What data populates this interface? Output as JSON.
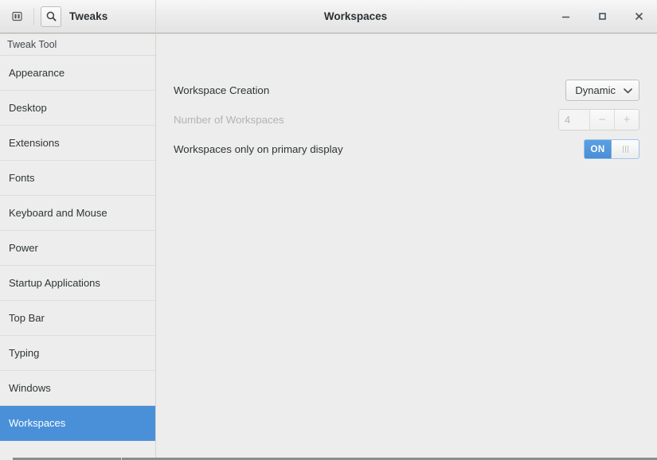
{
  "titlebar": {
    "sidebar_toggle_icon": "panel-toggle-icon",
    "search_icon": "search-icon",
    "app_name": "Tweaks",
    "window_title": "Workspaces",
    "minimize_label": "–",
    "maximize_label": "□",
    "close_label": "✕"
  },
  "sidebar": {
    "header": "Tweak Tool",
    "items": [
      {
        "label": "Appearance",
        "selected": false
      },
      {
        "label": "Desktop",
        "selected": false
      },
      {
        "label": "Extensions",
        "selected": false
      },
      {
        "label": "Fonts",
        "selected": false
      },
      {
        "label": "Keyboard and Mouse",
        "selected": false
      },
      {
        "label": "Power",
        "selected": false
      },
      {
        "label": "Startup Applications",
        "selected": false
      },
      {
        "label": "Top Bar",
        "selected": false
      },
      {
        "label": "Typing",
        "selected": false
      },
      {
        "label": "Windows",
        "selected": false
      },
      {
        "label": "Workspaces",
        "selected": true
      }
    ]
  },
  "content": {
    "rows": [
      {
        "label": "Workspace Creation",
        "disabled": false,
        "control": "combo",
        "value": "Dynamic",
        "chevron": "⌄"
      },
      {
        "label": "Number of Workspaces",
        "disabled": true,
        "control": "spinner",
        "value": "4",
        "minus_label": "−",
        "plus_label": "+"
      },
      {
        "label": "Workspaces only on primary display",
        "disabled": false,
        "control": "switch",
        "value": "ON"
      }
    ]
  },
  "colors": {
    "accent": "#4a90d9",
    "window_bg": "#ededed",
    "text": "#2e3436",
    "text_disabled": "#b3b3b0",
    "border": "#d4d4d1"
  }
}
